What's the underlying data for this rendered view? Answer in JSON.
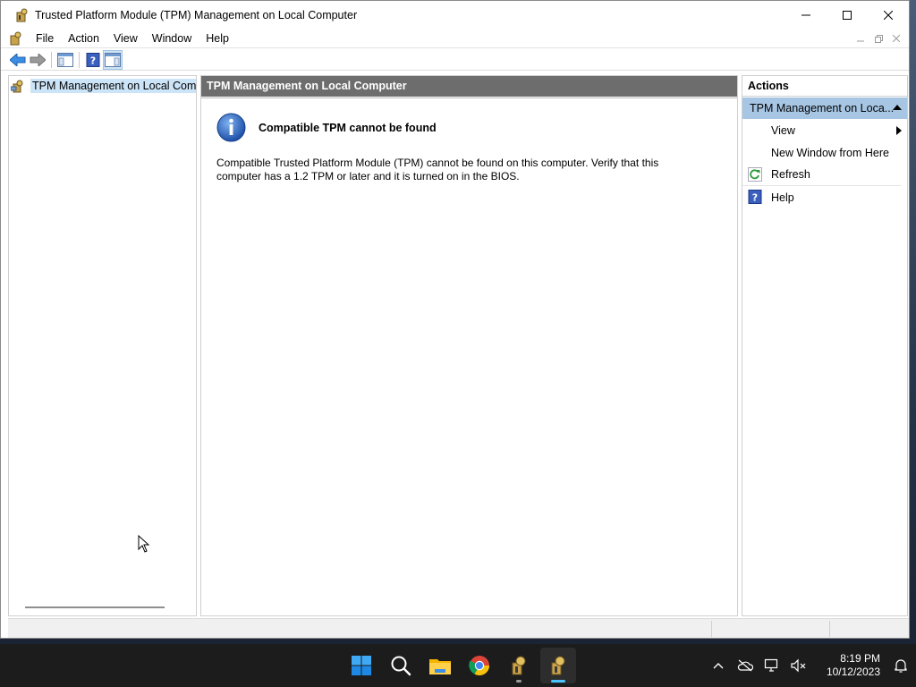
{
  "window": {
    "title": "Trusted Platform Module (TPM) Management on Local Computer"
  },
  "menubar": {
    "items": [
      "File",
      "Action",
      "View",
      "Window",
      "Help"
    ]
  },
  "tree": {
    "root_label": "TPM Management on Local Comp"
  },
  "center": {
    "header": "TPM Management on Local Computer",
    "heading": "Compatible TPM cannot be found",
    "body": "Compatible Trusted Platform Module (TPM) cannot be found on this computer. Verify that this computer has a 1.2 TPM or later and it is turned on in the BIOS."
  },
  "actions": {
    "title": "Actions",
    "section": "TPM Management on Loca...",
    "items": [
      {
        "label": "View",
        "icon": "none",
        "submenu": true
      },
      {
        "label": "New Window from Here",
        "icon": "none",
        "submenu": false
      },
      {
        "label": "Refresh",
        "icon": "refresh-icon",
        "submenu": false
      },
      {
        "label": "Help",
        "icon": "help-icon",
        "submenu": false
      }
    ]
  },
  "taskbar": {
    "apps": [
      "start-icon",
      "search-icon",
      "file-explorer-icon",
      "chrome-icon",
      "tpm-icon",
      "tpm-icon"
    ],
    "time": "8:19 PM",
    "date": "10/12/2023"
  },
  "colors": {
    "header_bg": "#6d6d6d",
    "selection_bg": "#cce4f7",
    "actions_section_bg": "#a7c6e4",
    "taskbar_bg": "#1c1c1c",
    "accent": "#4cc2ff"
  }
}
